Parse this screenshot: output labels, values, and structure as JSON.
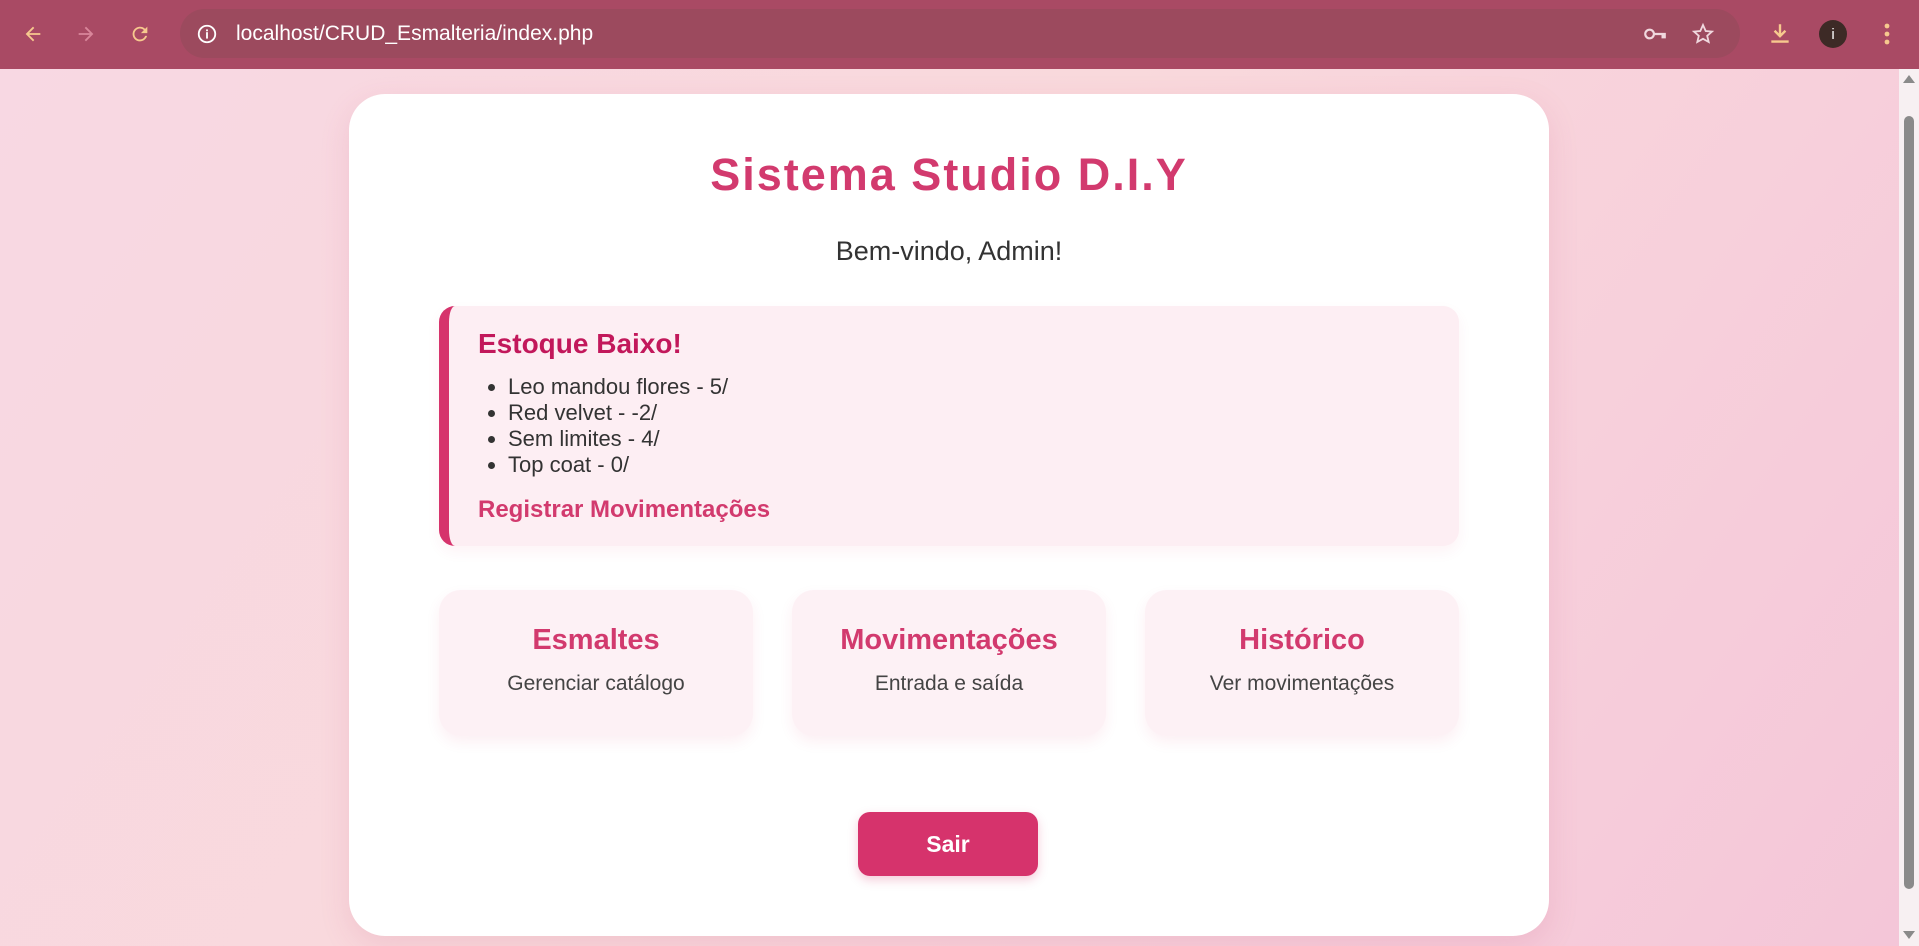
{
  "browser": {
    "url": "localhost/CRUD_Esmalteria/index.php",
    "profile_initial": "i"
  },
  "page": {
    "title": "Sistema Studio D.I.Y",
    "welcome": "Bem-vindo, Admin!"
  },
  "alert": {
    "title": "Estoque Baixo!",
    "items": [
      "Leo mandou flores - 5/",
      "Red velvet - -2/",
      "Sem limites - 4/",
      "Top coat - 0/"
    ],
    "link_label": "Registrar Movimentações"
  },
  "tiles": [
    {
      "title": "Esmaltes",
      "subtitle": "Gerenciar catálogo"
    },
    {
      "title": "Movimentações",
      "subtitle": "Entrada e saída"
    },
    {
      "title": "Histórico",
      "subtitle": "Ver movimentações"
    }
  ],
  "logout_label": "Sair",
  "colors": {
    "brand": "#d6336c",
    "chrome": "#a94a64"
  }
}
